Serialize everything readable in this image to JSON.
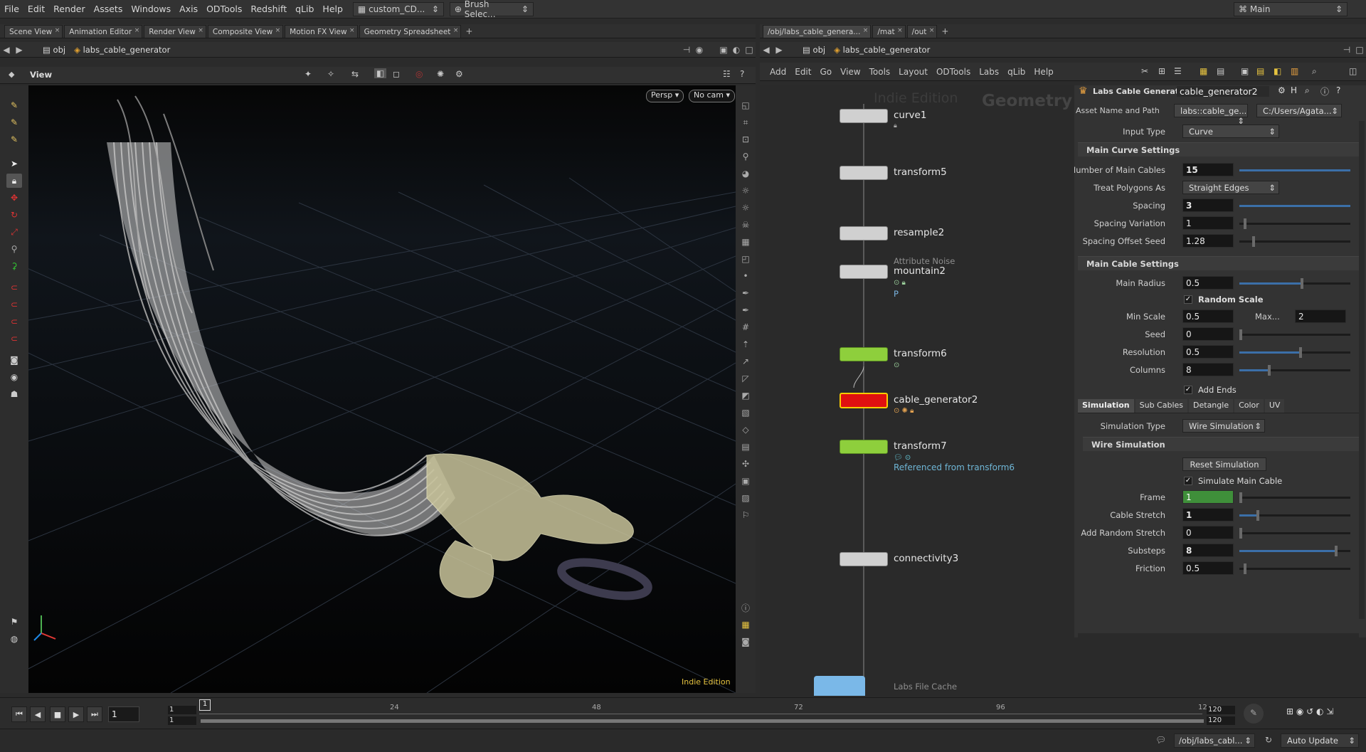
{
  "menu": [
    "File",
    "Edit",
    "Render",
    "Assets",
    "Windows",
    "Axis",
    "ODTools",
    "Redshift",
    "qLib",
    "Help"
  ],
  "shelf_selectors": [
    "custom_CD...",
    "Brush Selec..."
  ],
  "desktop_name": "Main",
  "left_tabs": [
    "Scene View",
    "Animation Editor",
    "Render View",
    "Composite View",
    "Motion FX View",
    "Geometry Spreadsheet"
  ],
  "left_path": {
    "root": "obj",
    "node": "labs_cable_generator"
  },
  "view_label": "View",
  "viewport": {
    "persp": "Persp",
    "cam": "No cam",
    "edition": "Indie Edition"
  },
  "right_tabs": [
    "/obj/labs_cable_genera...",
    "/mat",
    "/out"
  ],
  "right_path": {
    "root": "obj",
    "node": "labs_cable_generator"
  },
  "net_menu": [
    "Add",
    "Edit",
    "Go",
    "View",
    "Tools",
    "Layout",
    "ODTools",
    "Labs",
    "qLib",
    "Help"
  ],
  "net_watermark": {
    "edition": "Indie Edition",
    "context": "Geometry"
  },
  "nodes": [
    {
      "name": "curve1",
      "sub": ""
    },
    {
      "name": "transform5",
      "sub": ""
    },
    {
      "name": "resample2",
      "sub": ""
    },
    {
      "name": "mountain2",
      "type": "Attribute Noise",
      "sub": "P"
    },
    {
      "name": "transform6",
      "sub": ""
    },
    {
      "name": "cable_generator2",
      "sub": ""
    },
    {
      "name": "transform7",
      "sub": "Referenced from transform6"
    },
    {
      "name": "connectivity3",
      "sub": ""
    },
    {
      "name": "Labs File Cache",
      "sub": ""
    }
  ],
  "params": {
    "header_type": "Labs Cable Generator",
    "header_name": "cable_generator2",
    "asset_label": "Asset Name and Path",
    "asset_value": "labs::cable_ge...",
    "asset_path": "C:/Users/Agata...",
    "input_type_label": "Input Type",
    "input_type": "Curve",
    "sec_main_curve": "Main Curve Settings",
    "num_cables_label": "Number of Main Cables",
    "num_cables": "15",
    "treat_poly_label": "Treat Polygons As",
    "treat_poly": "Straight Edges",
    "spacing_label": "Spacing",
    "spacing": "3",
    "spacing_var_label": "Spacing Variation",
    "spacing_var": "1",
    "spacing_seed_label": "Spacing Offset Seed",
    "spacing_seed": "1.28",
    "sec_main_cable": "Main Cable Settings",
    "main_radius_label": "Main Radius",
    "main_radius": "0.5",
    "random_scale_label": "Random Scale",
    "min_scale_label": "Min Scale",
    "min_scale": "0.5",
    "max_label": "Max...",
    "max_scale": "2",
    "seed_label": "Seed",
    "seed": "0",
    "resolution_label": "Resolution",
    "resolution": "0.5",
    "columns_label": "Columns",
    "columns": "8",
    "add_ends_label": "Add Ends",
    "tabs": [
      "Simulation",
      "Sub Cables",
      "Detangle",
      "Color",
      "UV"
    ],
    "sim_type_label": "Simulation Type",
    "sim_type": "Wire Simulation",
    "sec_wire": "Wire Simulation",
    "reset_sim": "Reset Simulation",
    "sim_main_label": "Simulate Main Cable",
    "frame_label": "Frame",
    "frame": "1",
    "stretch_label": "Cable Stretch",
    "stretch": "1",
    "rand_stretch_label": "Add Random Stretch",
    "rand_stretch": "0",
    "substeps_label": "Substeps",
    "substeps": "8",
    "friction_label": "Friction",
    "friction": "0.5"
  },
  "timeline": {
    "frame": "1",
    "start": "1",
    "start2": "1",
    "end": "120",
    "end2": "120",
    "ticks": [
      "1",
      "24",
      "48",
      "72",
      "96",
      "12"
    ]
  },
  "status": {
    "path": "/obj/labs_cabl...",
    "update": "Auto Update"
  }
}
